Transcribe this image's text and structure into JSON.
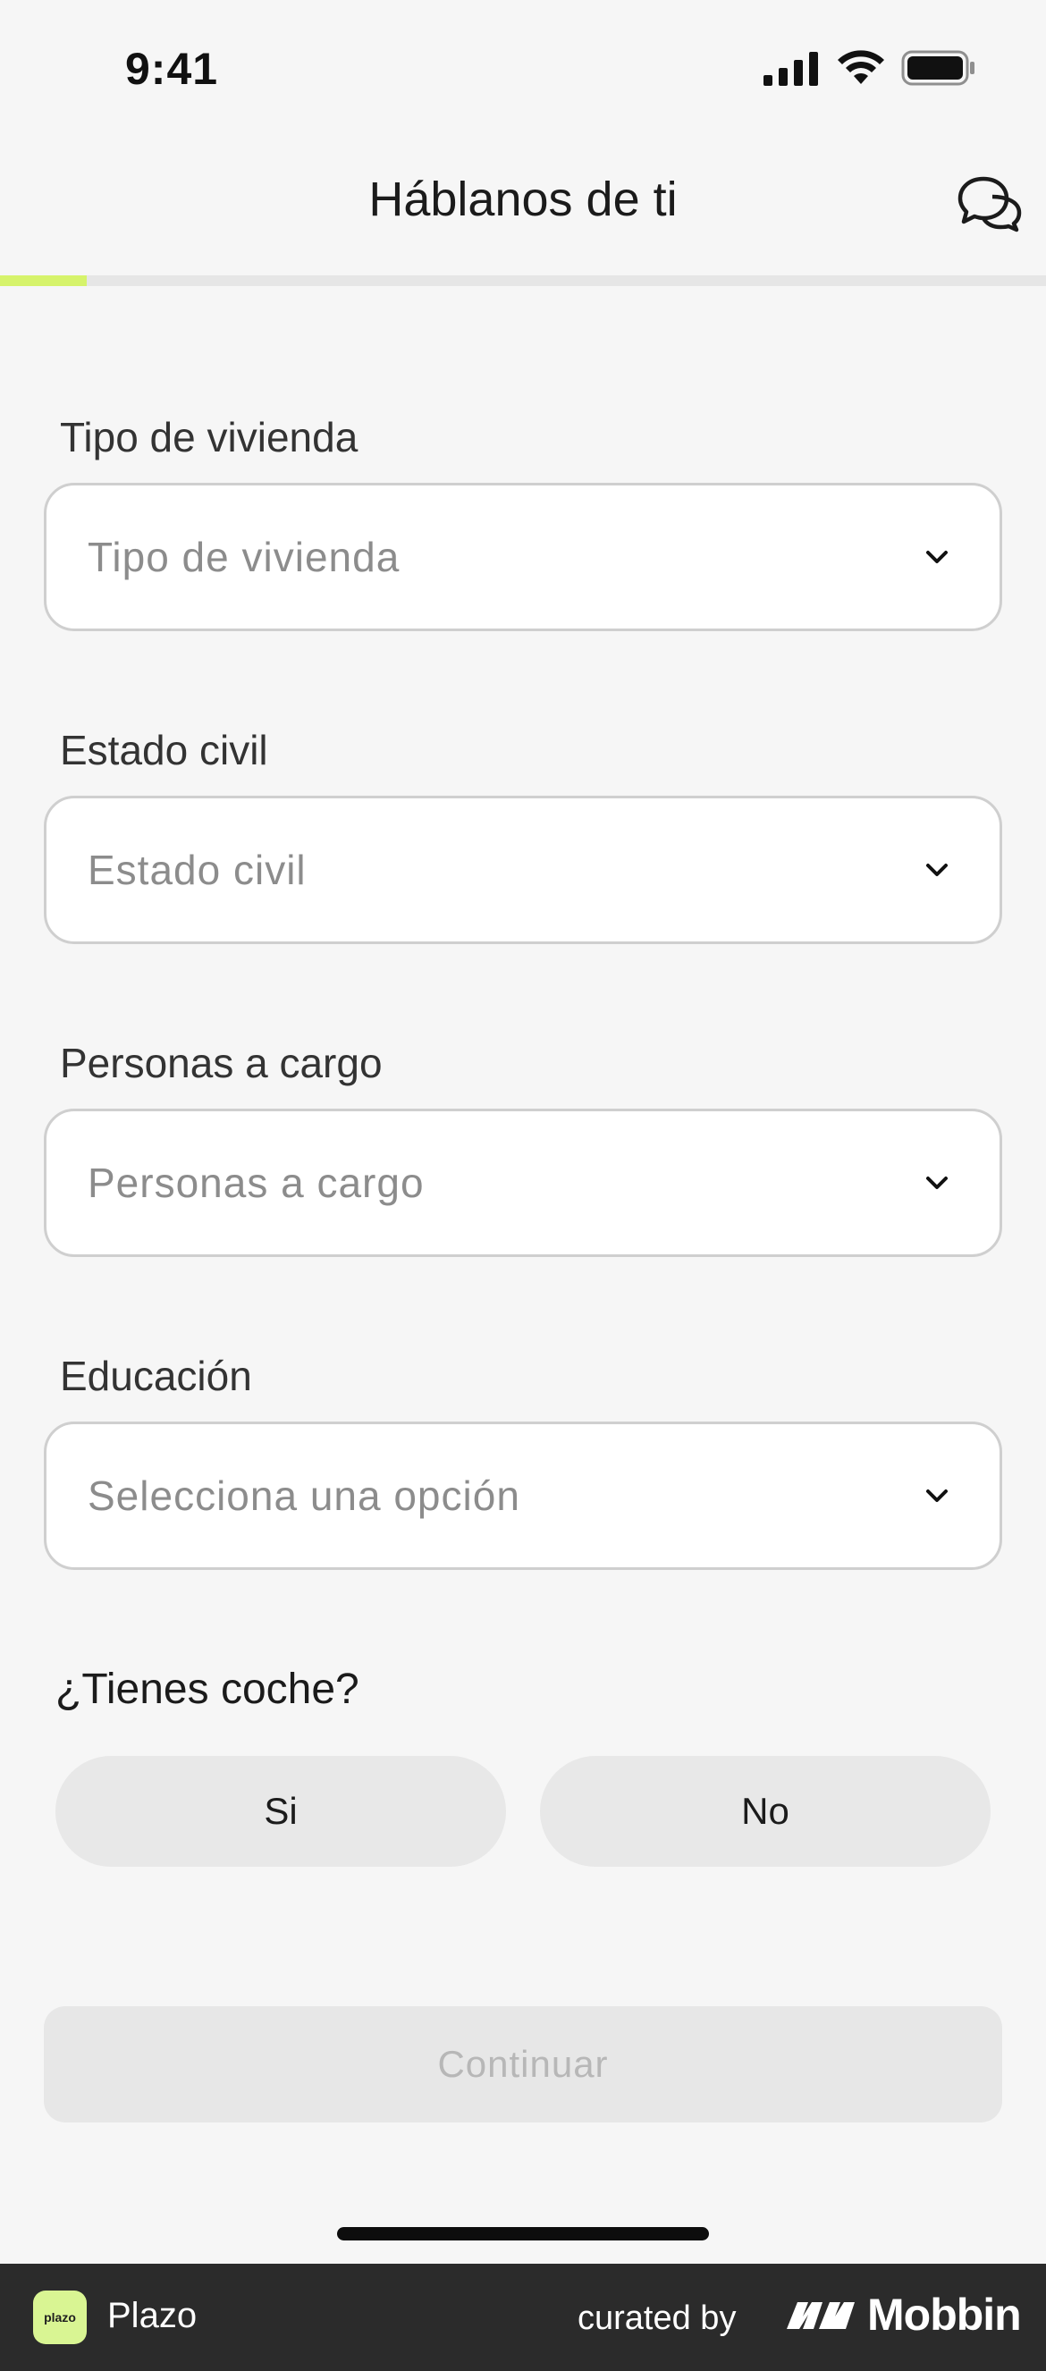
{
  "status_bar": {
    "time": "9:41",
    "icons": [
      "cellular-signal-icon",
      "wifi-icon",
      "battery-icon"
    ]
  },
  "nav": {
    "title": "Háblanos de ti",
    "icon": "chat-bubbles-icon"
  },
  "progress": {
    "fraction": 0.083,
    "color": "#d6f36b"
  },
  "fields": [
    {
      "label": "Tipo de vivienda",
      "placeholder": "Tipo de vivienda"
    },
    {
      "label": "Estado civil",
      "placeholder": "Estado civil"
    },
    {
      "label": "Personas a cargo",
      "placeholder": "Personas a cargo"
    },
    {
      "label": "Educación",
      "placeholder": "Selecciona una opción"
    }
  ],
  "car_question": {
    "label": "¿Tienes coche?",
    "options": [
      "Si",
      "No"
    ]
  },
  "continue_label": "Continuar",
  "footer": {
    "app_name": "Plazo",
    "logo_text": "plazo",
    "curated_by": "curated by",
    "brand": "Mobbin"
  },
  "colors": {
    "accent": "#d6f36b",
    "background": "#f6f6f6",
    "footer": "#2b2b2b"
  }
}
